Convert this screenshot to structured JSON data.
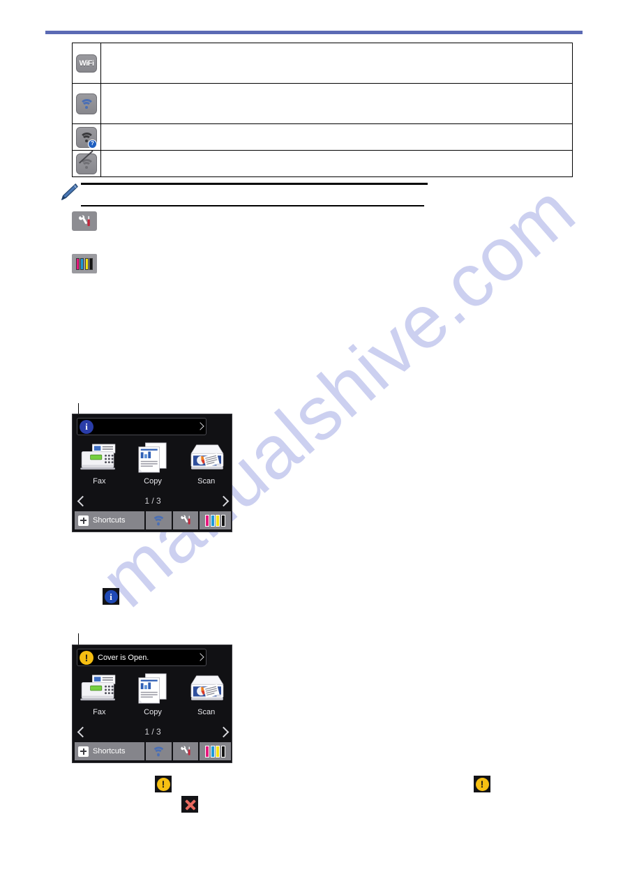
{
  "document": {
    "type": "printer-user-guide-page",
    "watermark": "manualshive.com",
    "accent_rule_color": "#5b6ab4"
  },
  "status_icon_table": {
    "rows": [
      {
        "icon": "wifi-text-badge-icon",
        "icon_label": "WiFi",
        "description": ""
      },
      {
        "icon": "wifi-connected-icon",
        "icon_label": "",
        "description": ""
      },
      {
        "icon": "wifi-question-icon",
        "icon_label": "",
        "description": ""
      },
      {
        "icon": "wifi-disabled-icon",
        "icon_label": "",
        "description": ""
      }
    ]
  },
  "note": {
    "icon": "pencil-note-icon",
    "line1": "",
    "line2": ""
  },
  "inline_icons": [
    {
      "icon": "settings-wrench-screwdriver-icon",
      "label": ""
    },
    {
      "icon": "ink-cartridge-icon",
      "label": ""
    }
  ],
  "lcd_screen_info": {
    "caption": "",
    "statusbar": {
      "icon": "info-icon",
      "icon_glyph": "i",
      "text": "",
      "chevron": "chevron-right-icon"
    },
    "apps": [
      {
        "name": "Fax",
        "icon": "fax-machine-icon"
      },
      {
        "name": "Copy",
        "icon": "copy-documents-icon"
      },
      {
        "name": "Scan",
        "icon": "flatbed-scanner-icon"
      }
    ],
    "pager": {
      "label": "1 / 3",
      "prev": "chevron-left-icon",
      "next": "chevron-right-icon"
    },
    "taskbar": {
      "shortcuts_label": "Shortcuts",
      "shortcuts_icon": "plus-icon",
      "wifi_icon": "wifi-connected-icon",
      "settings_icon": "settings-wrench-screwdriver-icon",
      "ink_icon": "ink-cartridge-icon"
    }
  },
  "lcd_screen_warning": {
    "statusbar": {
      "icon": "warning-icon",
      "icon_glyph": "!",
      "text": "Cover is Open.",
      "chevron": "chevron-right-icon"
    },
    "apps": [
      {
        "name": "Fax",
        "icon": "fax-machine-icon"
      },
      {
        "name": "Copy",
        "icon": "copy-documents-icon"
      },
      {
        "name": "Scan",
        "icon": "flatbed-scanner-icon"
      }
    ],
    "pager": {
      "label": "1 / 3",
      "prev": "chevron-left-icon",
      "next": "chevron-right-icon"
    },
    "taskbar": {
      "shortcuts_label": "Shortcuts",
      "shortcuts_icon": "plus-icon",
      "wifi_icon": "wifi-connected-icon",
      "settings_icon": "settings-wrench-screwdriver-icon",
      "ink_icon": "ink-cartridge-icon"
    }
  },
  "standalone_icons": [
    {
      "icon": "info-icon",
      "glyph": "i",
      "caption": ""
    },
    {
      "icon": "warning-icon",
      "glyph": "!",
      "caption": ""
    },
    {
      "icon": "error-cross-icon",
      "glyph": "",
      "caption": ""
    },
    {
      "icon": "warning-icon-right",
      "glyph": "!",
      "caption": ""
    }
  ],
  "ink_colors": [
    "#e6197d",
    "#1d9ad6",
    "#f5e313",
    "#141414"
  ],
  "colors": {
    "lcd_background": "#111114",
    "taskbar_grey": "#85858b",
    "info_blue": "#1f49b5",
    "warning_yellow": "#f6c013",
    "error_red": "#e8695f"
  }
}
